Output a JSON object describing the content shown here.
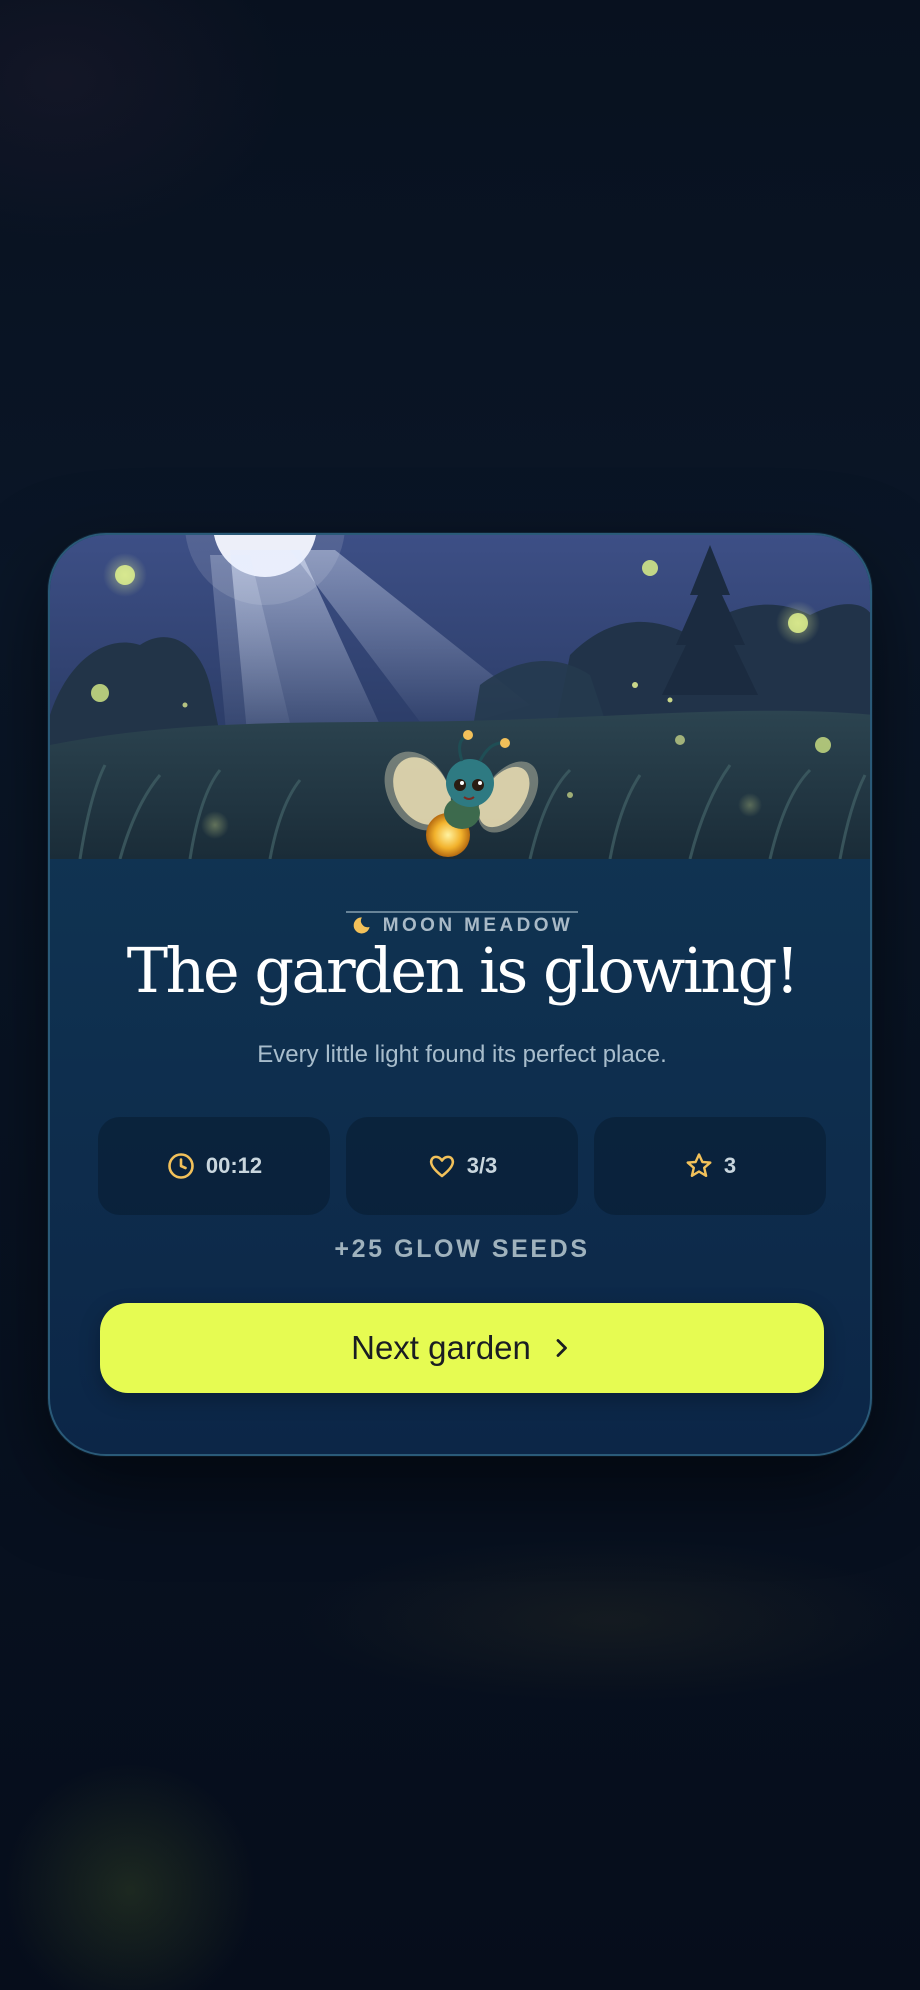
{
  "card": {
    "eyebrow": "MOON MEADOW",
    "title": "The garden is glowing!",
    "subtitle": "Every little light found its perfect place.",
    "stats": [
      {
        "icon": "clock-icon",
        "value": "00:12"
      },
      {
        "icon": "heart-icon",
        "value": "3/3"
      },
      {
        "icon": "star-icon",
        "value": "3"
      }
    ],
    "reward": "+25 GLOW SEEDS",
    "next_button": {
      "label": "Next garden",
      "icon": "chevron-right-icon"
    }
  },
  "colors": {
    "accent": "#e6fb52",
    "icon_gold": "#f2c15a",
    "card_bg": "#0f3150",
    "page_bg": "#070f1f"
  }
}
